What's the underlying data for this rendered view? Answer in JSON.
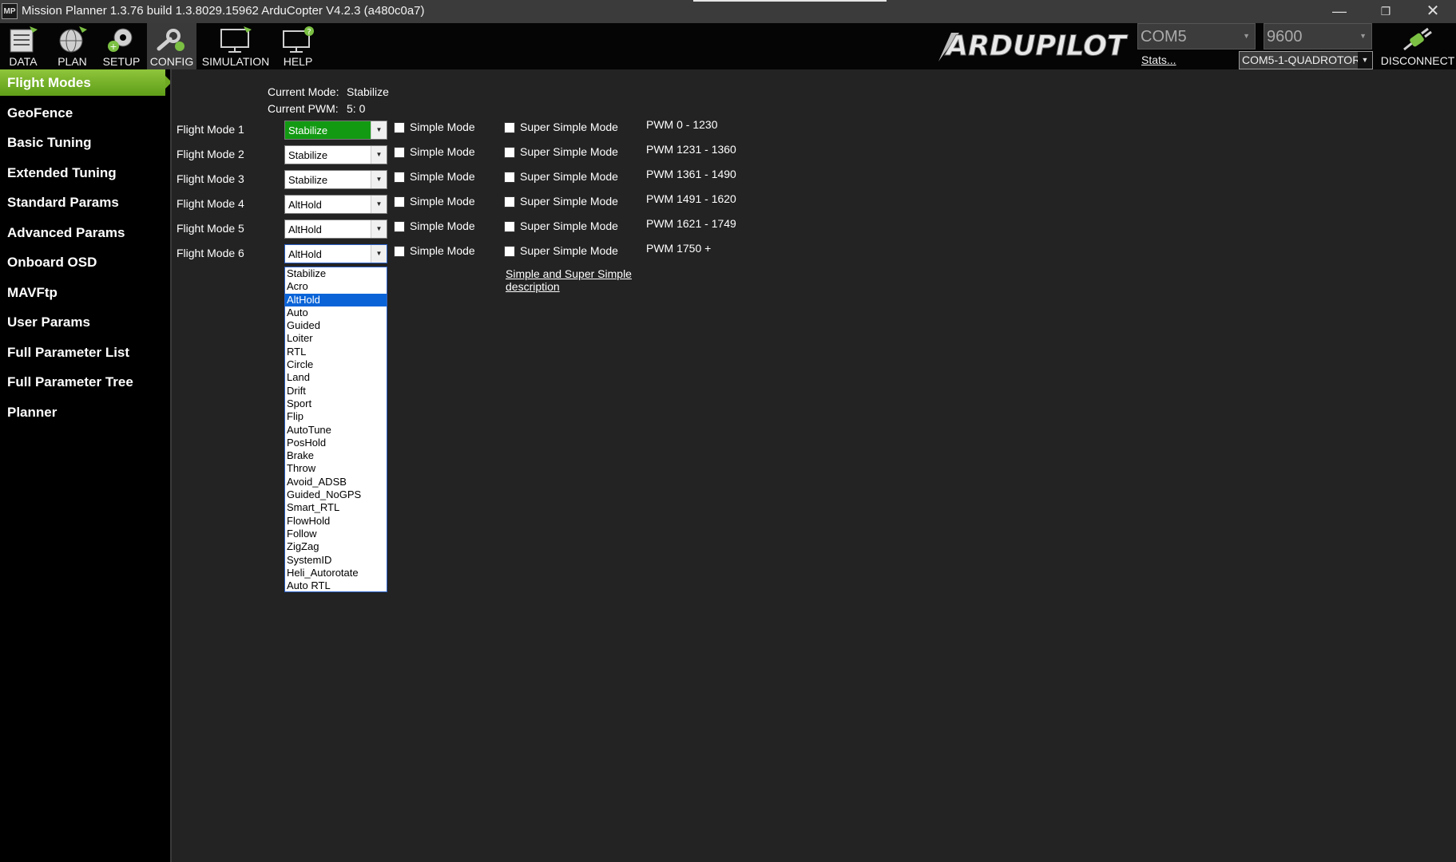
{
  "titlebar": {
    "title": "Mission Planner 1.3.76 build 1.3.8029.15962 ArduCopter V4.2.3 (a480c0a7)",
    "app_icon": "MP",
    "minimize": "—",
    "restore": "❐",
    "close": "✕"
  },
  "toolbar": {
    "nav": [
      {
        "label": "DATA",
        "icon": "data-icon"
      },
      {
        "label": "PLAN",
        "icon": "globe-icon"
      },
      {
        "label": "SETUP",
        "icon": "setup-icon"
      },
      {
        "label": "CONFIG",
        "icon": "config-icon"
      },
      {
        "label": "SIMULATION",
        "icon": "monitor-icon"
      },
      {
        "label": "HELP",
        "icon": "help-icon"
      }
    ],
    "logo_text": "ARDUPILOT",
    "port": "COM5",
    "baud": "9600",
    "stats_link": "Stats...",
    "vehicle": "COM5-1-QUADROTOR",
    "disconnect_label": "DISCONNECT",
    "active": "CONFIG",
    "colors": {
      "toolbar_bg": "#050505",
      "active_bg": "#3a3a3a"
    }
  },
  "sidebar": {
    "items": [
      "Flight Modes",
      "GeoFence",
      "Basic Tuning",
      "Extended Tuning",
      "Standard Params",
      "Advanced Params",
      "Onboard OSD",
      "MAVFtp",
      "User Params",
      "Full Parameter List",
      "Full Parameter Tree",
      "Planner"
    ],
    "active_index": 0,
    "active_color": "#7ab52b"
  },
  "main": {
    "current_mode_label": "Current Mode:",
    "current_mode_value": "Stabilize",
    "current_pwm_label": "Current PWM:",
    "current_pwm_value": "5: 0",
    "modes": [
      {
        "label": "Flight Mode 1",
        "value": "Stabilize",
        "simple": "Simple Mode",
        "super_simple": "Super Simple Mode",
        "pwm": "PWM 0 - 1230",
        "highlight": true
      },
      {
        "label": "Flight Mode 2",
        "value": "Stabilize",
        "simple": "Simple Mode",
        "super_simple": "Super Simple Mode",
        "pwm": "PWM 1231 - 1360"
      },
      {
        "label": "Flight Mode 3",
        "value": "Stabilize",
        "simple": "Simple Mode",
        "super_simple": "Super Simple Mode",
        "pwm": "PWM 1361 - 1490"
      },
      {
        "label": "Flight Mode 4",
        "value": "AltHold",
        "simple": "Simple Mode",
        "super_simple": "Super Simple Mode",
        "pwm": "PWM 1491 - 1620"
      },
      {
        "label": "Flight Mode 5",
        "value": "AltHold",
        "simple": "Simple Mode",
        "super_simple": "Super Simple Mode",
        "pwm": "PWM 1621 - 1749"
      },
      {
        "label": "Flight Mode 6",
        "value": "AltHold",
        "simple": "Simple Mode",
        "super_simple": "Super Simple Mode",
        "pwm": "PWM 1750 +"
      }
    ],
    "description_link": "Simple and Super Simple description",
    "dropdown": {
      "options": [
        "Stabilize",
        "Acro",
        "AltHold",
        "Auto",
        "Guided",
        "Loiter",
        "RTL",
        "Circle",
        "Land",
        "Drift",
        "Sport",
        "Flip",
        "AutoTune",
        "PosHold",
        "Brake",
        "Throw",
        "Avoid_ADSB",
        "Guided_NoGPS",
        "Smart_RTL",
        "FlowHold",
        "Follow",
        "ZigZag",
        "SystemID",
        "Heli_Autorotate",
        "Auto RTL"
      ],
      "selected_index": 2,
      "highlight_color": "#0a64d8"
    }
  }
}
